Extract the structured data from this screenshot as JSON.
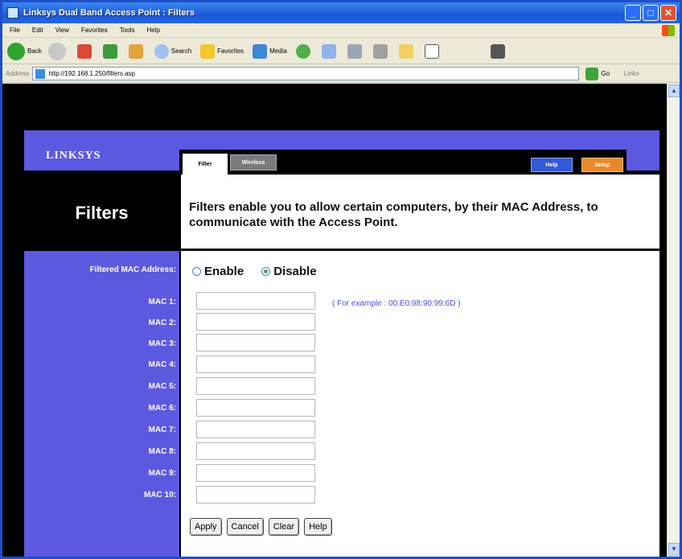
{
  "window": {
    "title": "Linksys Dual Band Access Point : Filters"
  },
  "menu": [
    "File",
    "Edit",
    "View",
    "Favorites",
    "Tools",
    "Help"
  ],
  "toolbar": {
    "back": "Back",
    "search": "Search",
    "favorites": "Favorites",
    "media": "Media"
  },
  "address": {
    "label": "Address",
    "url": "http://192.168.1.250/filters.asp",
    "go": "Go",
    "links": "Links"
  },
  "page": {
    "logo": "LINKSYS",
    "tabs": {
      "filter": "Filter",
      "wireless": "Wireless"
    },
    "nav": {
      "help": "Help",
      "setup": "Setup"
    },
    "title": "Filters",
    "description": "Filters enable you to allow certain computers, by their MAC Address, to communicate with the Access Point.",
    "filtered_label": "Filtered MAC Address:",
    "enable": "Enable",
    "disable": "Disable",
    "selected": "Disable",
    "mac_labels": [
      "MAC 1:",
      "MAC 2:",
      "MAC 3:",
      "MAC 4:",
      "MAC 5:",
      "MAC 6:",
      "MAC 7:",
      "MAC 8:",
      "MAC 9:",
      "MAC 10:"
    ],
    "example": "( For example : 00:E0:98:90:99:6D )",
    "buttons": {
      "apply": "Apply",
      "cancel": "Cancel",
      "clear": "Clear",
      "help": "Help"
    }
  },
  "colors": {
    "brand_blue": "#5b59e0",
    "setup_orange": "#e9892a",
    "help_blue": "#3359d8"
  }
}
